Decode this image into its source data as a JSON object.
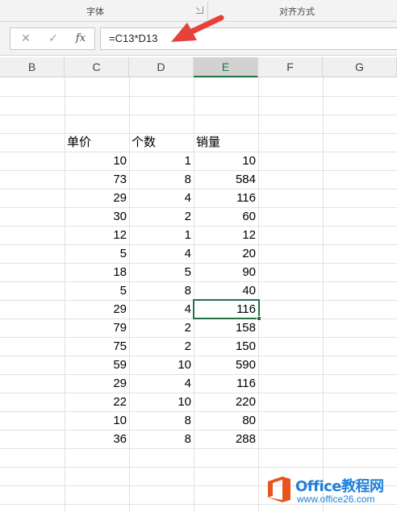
{
  "ribbon": {
    "font_group": "字体",
    "align_group": "对齐方式"
  },
  "formula_bar": {
    "cancel_glyph": "✕",
    "enter_glyph": "✓",
    "fx_glyph": "fx",
    "formula": "=C13*D13"
  },
  "columns": [
    "B",
    "C",
    "D",
    "E",
    "F",
    "G"
  ],
  "active_column": "E",
  "table": {
    "headers": [
      "单价",
      "个数",
      "销量"
    ],
    "rows": [
      [
        "10",
        "1",
        "10"
      ],
      [
        "73",
        "8",
        "584"
      ],
      [
        "29",
        "4",
        "116"
      ],
      [
        "30",
        "2",
        "60"
      ],
      [
        "12",
        "1",
        "12"
      ],
      [
        "5",
        "4",
        "20"
      ],
      [
        "18",
        "5",
        "90"
      ],
      [
        "5",
        "8",
        "40"
      ],
      [
        "29",
        "4",
        "116"
      ],
      [
        "79",
        "2",
        "158"
      ],
      [
        "75",
        "2",
        "150"
      ],
      [
        "59",
        "10",
        "590"
      ],
      [
        "29",
        "4",
        "116"
      ],
      [
        "22",
        "10",
        "220"
      ],
      [
        "10",
        "8",
        "80"
      ],
      [
        "36",
        "8",
        "288"
      ]
    ],
    "selected_row_index": 8
  },
  "colors": {
    "excel_green": "#217346",
    "arrow_red": "#e8413a",
    "logo_orange": "#e8541e",
    "logo_blue": "#1e7fd8"
  },
  "watermark": {
    "title": "Office教程网",
    "url": "www.office26.com"
  }
}
